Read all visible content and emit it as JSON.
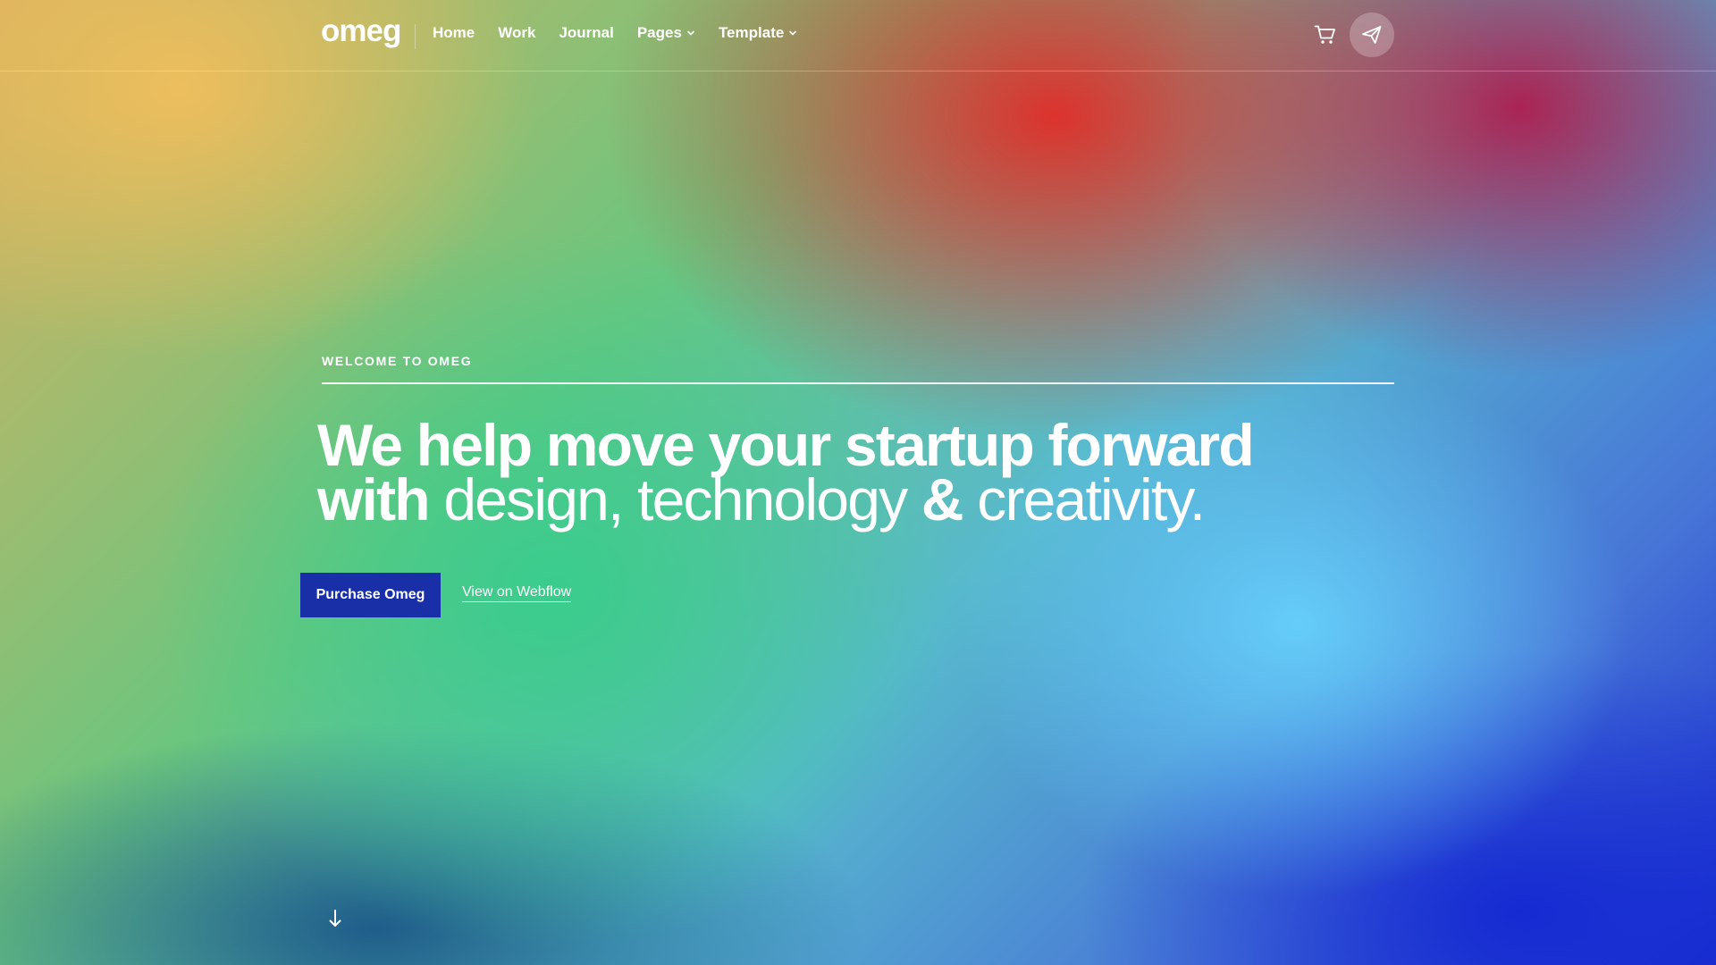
{
  "header": {
    "brand": "omeg",
    "nav": [
      {
        "label": "Home",
        "has_dropdown": false
      },
      {
        "label": "Work",
        "has_dropdown": false
      },
      {
        "label": "Journal",
        "has_dropdown": false
      },
      {
        "label": "Pages",
        "has_dropdown": true
      },
      {
        "label": "Template",
        "has_dropdown": true
      }
    ],
    "icons": {
      "cart": "cart-icon",
      "send": "paper-plane-icon"
    }
  },
  "hero": {
    "eyebrow": "WELCOME TO OMEG",
    "title_line_1": "We help move your startup forward",
    "title_line_2_parts": [
      {
        "text": "with ",
        "style": "bold"
      },
      {
        "text": "design, technology ",
        "style": "light"
      },
      {
        "text": "& ",
        "style": "bold"
      },
      {
        "text": "creativity.",
        "style": "light"
      }
    ],
    "buttons": {
      "primary": "Purchase Omeg",
      "secondary": "View on Webflow"
    },
    "scroll_icon": "arrow-down-icon"
  },
  "colors": {
    "text": "#ffffff",
    "primary_button": "#182fa8",
    "icon_circle": "rgba(255,255,255,0.24)"
  }
}
